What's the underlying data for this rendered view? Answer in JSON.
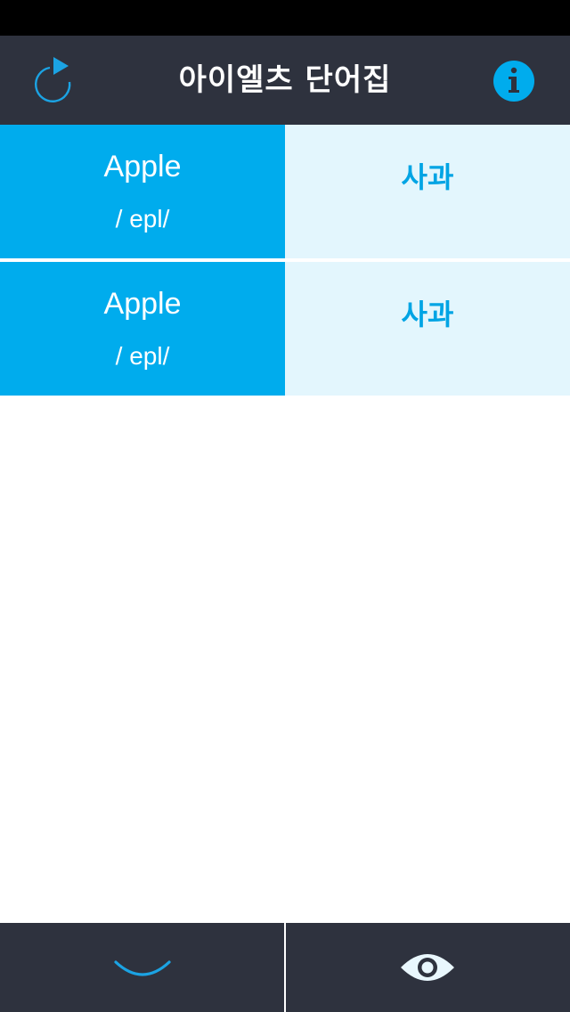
{
  "header": {
    "title": "아이엘츠 단어집",
    "refresh_icon": "refresh-icon",
    "info_icon": "info-icon"
  },
  "words": [
    {
      "word": "Apple",
      "pronunciation": "/ epl/",
      "meaning": "사과"
    },
    {
      "word": "Apple",
      "pronunciation": "/ epl/",
      "meaning": "사과"
    }
  ],
  "tab_bar": {
    "left_icon": "smile-icon",
    "right_icon": "eye-icon"
  },
  "colors": {
    "nav_background": "#2e323e",
    "accent_blue": "#00aced",
    "meaning_background": "#e3f6fd",
    "meaning_text": "#00a4e4",
    "status_bar": "#000000"
  }
}
